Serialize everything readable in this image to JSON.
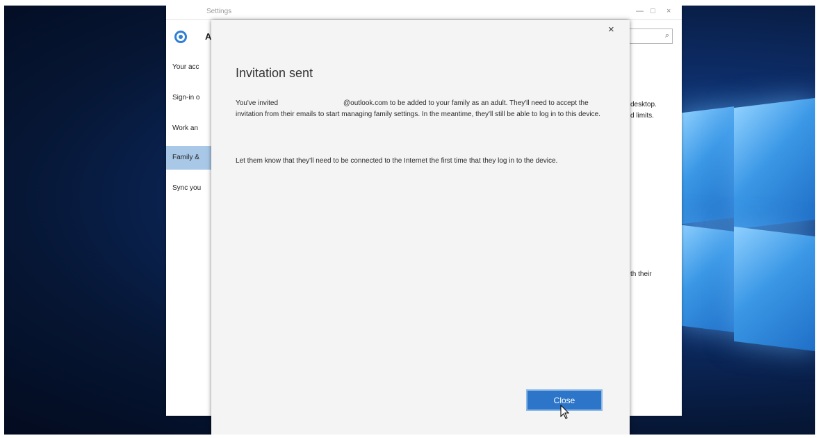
{
  "settings_window": {
    "title": "Settings",
    "heading": "A",
    "sidebar": {
      "items": [
        {
          "label": "Your acc",
          "selected": false
        },
        {
          "label": "Sign-in o",
          "selected": false
        },
        {
          "label": "Work an",
          "selected": false
        },
        {
          "label": "Family &",
          "selected": true
        },
        {
          "label": "Sync you",
          "selected": false
        }
      ]
    },
    "right_text": {
      "line1": "desktop.",
      "line2": "d limits.",
      "line3": "th their"
    },
    "icons": {
      "settings": "gear-icon",
      "search": "search-icon"
    }
  },
  "dialog": {
    "close_glyph": "×",
    "title": "Invitation sent",
    "paragraph1": {
      "prefix": "You've invited",
      "suffix": "@outlook.com to be added to your family as an adult. They'll need to accept the invitation from their emails to start managing family settings. In the meantime, they'll still be able to log in to this device."
    },
    "paragraph2": "Let them know that they'll need to be connected to the Internet the first time that they log in to the device.",
    "close_button_label": "Close"
  },
  "colors": {
    "accent": "#2c75c9",
    "sidebar_selected": "#a9c8e8"
  }
}
